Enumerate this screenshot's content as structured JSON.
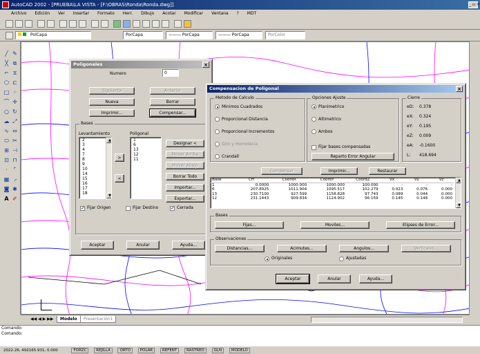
{
  "app": {
    "title": "AutoCAD 2002 - [PRUEBA\\LA VISTA - [F:\\OBRAS\\Ronda\\Ronda.dwg]]",
    "menu": [
      "Archivo",
      "Edición",
      "Ver",
      "Insertar",
      "Formato",
      "Herr.",
      "Dibujo",
      "Acotar",
      "Modificar",
      "Ventana",
      "?",
      "MDT"
    ],
    "layer_combo": "PolCapa",
    "linetype_combo": "PorCapa",
    "lineweight_combo": "PorCapa",
    "plotstyle_combo": "PorColor"
  },
  "poligonales": {
    "title": "Poligonales",
    "numero_label": "Numero",
    "numero_value": "0",
    "btn_siguiente": "Siguiente",
    "btn_anterior": "Anterior",
    "btn_nueva": "Nueva",
    "btn_borrar": "Borrar",
    "btn_imprimir": "Imprimir...",
    "btn_compensar": "Compensar...",
    "bases_group": "Bases",
    "col_levantamiento": "Levantamiento",
    "col_poligonal": "Poligonal",
    "levantamiento_items": [
      "2",
      "3",
      "4",
      "7",
      "8",
      "9",
      "10",
      "14",
      "15",
      "16",
      "17",
      "18"
    ],
    "poligonal_items": [
      "1",
      "6",
      "13",
      "12",
      "11"
    ],
    "btn_arrow_right": ">",
    "btn_arrow_left": "<",
    "btn_designar": "Designar <",
    "btn_mover_arriba": "Mover Arriba",
    "btn_mover_abajo": "Mover Abajo",
    "btn_borrar_todo": "Borrar Todo",
    "btn_importar": "Importar...",
    "btn_exportar": "Exportar...",
    "chk_fijar_origen": "Fijar Origen",
    "chk_fijar_destino": "Fijar Destino",
    "chk_cerrada": "Cerrada",
    "btn_aceptar": "Aceptar",
    "btn_anular": "Anular",
    "btn_ayuda": "Ayuda..."
  },
  "compensacion": {
    "title": "Compensacion de Poligonal",
    "metodo_group": "Metodo de Calculo",
    "metodos": [
      "Minimos Cuadrados",
      "Proporcional Distancia",
      "Proporcional Incrementos",
      "Giro y Homotecia",
      "Crandall"
    ],
    "ajuste_group": "Opciones Ajuste",
    "ajustes": [
      "Planimetrico",
      "Altimetrico",
      "Ambos"
    ],
    "chk_fijar_bases": "Fijar bases compensadas",
    "btn_reparto": "Reparto Error Angular",
    "cierre_group": "Cierre",
    "cierre": [
      {
        "label": "eD:",
        "value": "0.378"
      },
      {
        "label": "eX:",
        "value": "0.324"
      },
      {
        "label": "eY:",
        "value": "0.195"
      },
      {
        "label": "eZ:",
        "value": "0.009"
      },
      {
        "label": "eA:",
        "value": "-0.1600"
      },
      {
        "label": "L:",
        "value": "418.694"
      }
    ],
    "btn_compensar": "Compensar",
    "btn_imprimir": "Imprimir...",
    "btn_restaurar": "Restaurar",
    "table_headers": [
      "Base",
      "CH",
      "CoordX",
      "CoordY",
      "CoordZ",
      "Vx",
      "Vy",
      "Vz"
    ],
    "table_rows": [
      [
        "1",
        "0.0000",
        "1000.000",
        "1000.000",
        "100.000",
        "-",
        "-",
        "-"
      ],
      [
        "6",
        "207.8925",
        "1011.904",
        "1095.517",
        "102.279",
        "0.023",
        "0.076",
        "0.000"
      ],
      [
        "13",
        "230.7100",
        "927.599",
        "1158.828",
        "97.743",
        "0.089",
        "0.044",
        "0.000"
      ],
      [
        "12",
        "231.1443",
        "909.834",
        "1124.902",
        "96.159",
        "0.145",
        "0.148",
        "0.000"
      ]
    ],
    "bases_group": "Bases",
    "btn_fijas": "Fijas...",
    "btn_moviles": "Moviles...",
    "btn_elipses": "Elipses de Error...",
    "obs_group": "Observaciones",
    "btn_distancias": "Distancias...",
    "btn_acimutes": "Acimutes...",
    "btn_angulos": "Angulos...",
    "btn_verticales": "Verticales...",
    "radio_originales": "Originales",
    "radio_ajustadas": "Ajustadas",
    "btn_aceptar": "Aceptar",
    "btn_anular": "Anular",
    "btn_ayuda": "Ayuda..."
  },
  "layout_tabs": [
    "Modelo",
    "Presentación1"
  ],
  "command_lines": [
    "Comando:",
    "Comando:"
  ],
  "status": {
    "coords": "2022.26, 492165.931, 0.000",
    "toggles": [
      "FORZC",
      "REJILLA",
      "ORTO",
      "POLAR",
      "REFENT",
      "RASTREO",
      "GLN",
      "MODELO"
    ]
  }
}
